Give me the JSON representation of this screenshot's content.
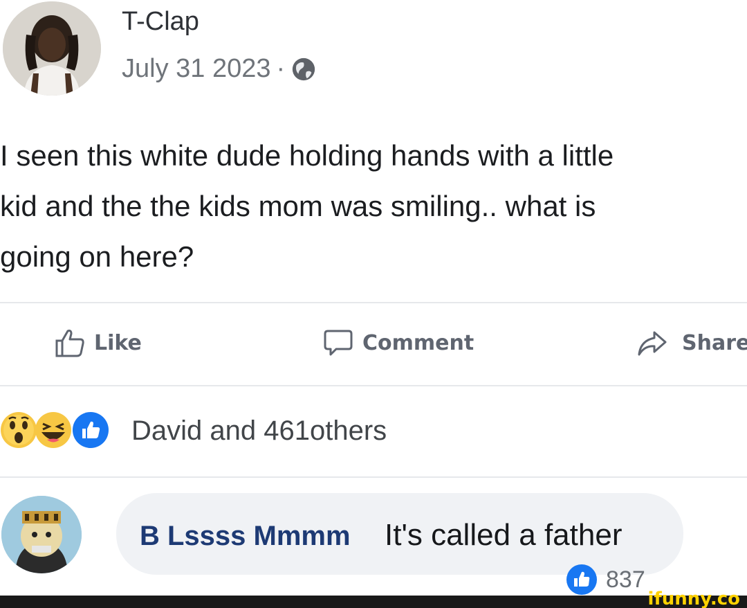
{
  "post": {
    "author": "T-Clap",
    "date": "July 31 2023",
    "separator": "·",
    "privacy_icon": "globe-icon",
    "text_lines": [
      "I seen this white dude holding hands with a little",
      "kid and the the kids mom was smiling.. what is",
      "going on here?"
    ]
  },
  "actions": {
    "like_label": "Like",
    "comment_label": "Comment",
    "share_label": "Share"
  },
  "reactions": {
    "icons": [
      "wow-reaction-icon",
      "haha-reaction-icon",
      "like-reaction-icon"
    ],
    "summary": "David and 461others"
  },
  "comment": {
    "author": "B Lssss Mmmm",
    "text": "It's called a father",
    "like_count": "837"
  },
  "watermark": "ifunny.co",
  "colors": {
    "like_blue": "#1877f2",
    "comment_author": "#1d3a74",
    "watermark": "#ffd200"
  }
}
